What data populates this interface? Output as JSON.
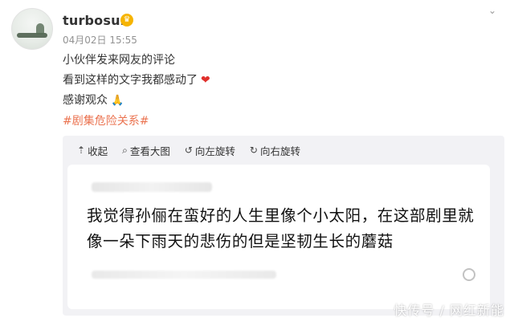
{
  "post": {
    "username": "turbosun",
    "badge_icon": "vip-crown-icon",
    "timestamp": "04月02日 15:55",
    "lines": [
      "小伙伴发来网友的评论",
      "看到这样的文字我都感动了",
      "感谢观众"
    ],
    "hashtag": "#剧集危险关系#"
  },
  "toolbar": {
    "collapse": "收起",
    "view_large": "查看大图",
    "rotate_left": "向左旋转",
    "rotate_right": "向右旋转"
  },
  "image": {
    "comment_text": "我觉得孙俪在蛮好的人生里像个小太阳，在这部剧里就像一朵下雨天的悲伤的但是坚韧生长的蘑菇"
  },
  "watermark": "快传号 / 网红新能"
}
